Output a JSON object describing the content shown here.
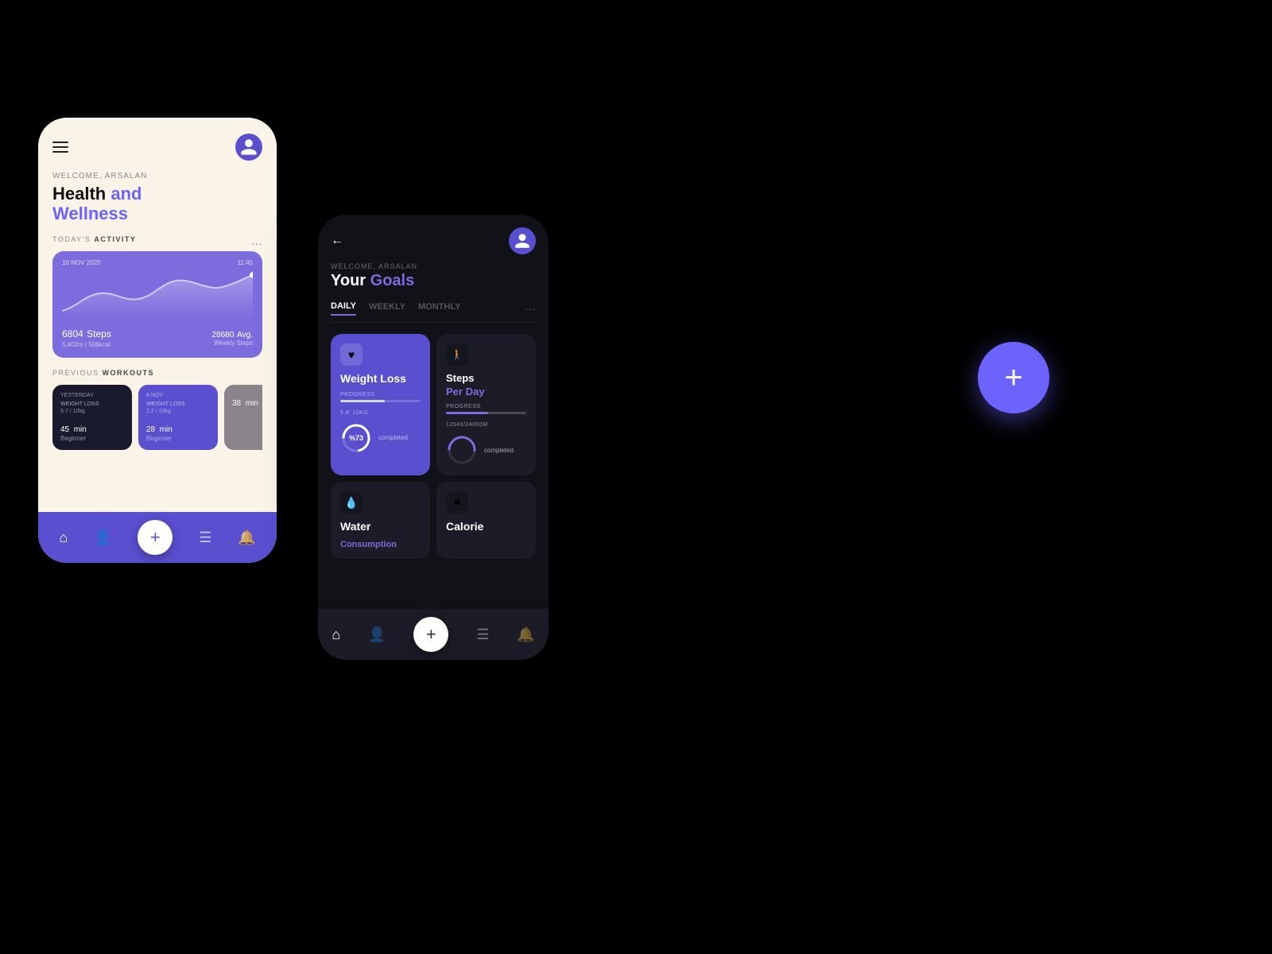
{
  "page": {
    "background": "#000000"
  },
  "phone_light": {
    "welcome_label": "WELCOME, ARSALAN",
    "headline_normal": "Health ",
    "headline_accent": "and",
    "headline_line2": "Wellness",
    "todays_activity": "TODAY'S",
    "activity_bold": "ACTIVITY",
    "chart_date": "10 NOV 2020",
    "chart_time": "11:45",
    "steps_count": "6804",
    "steps_label": "Steps",
    "steps_sub": "5,402m | 508kcal",
    "avg_count": "28680",
    "avg_label": "Avg.",
    "avg_sub": "Weekly Steps",
    "prev_workouts": "PREVIOUS",
    "workouts_bold": "WORKOUTS",
    "workout1_date": "YESTERDAY",
    "workout1_type": "WEIGHT LOSS",
    "workout1_progress": "5.7 / 10kg",
    "workout1_time": "45",
    "workout1_unit": "min",
    "workout1_level": "Beginner",
    "workout2_date": "8 NOV",
    "workout2_type": "WEIGHT LOSS",
    "workout2_progress": "2.2 / 10kg",
    "workout2_time": "28",
    "workout2_unit": "min",
    "workout2_level": "Beginner",
    "workout3_time": "38",
    "workout3_unit": "min"
  },
  "phone_dark": {
    "back": "←",
    "welcome_label": "WELCOME, ARSALAN",
    "headline_normal": "Your ",
    "headline_accent": "Goals",
    "tab_daily": "DAILY",
    "tab_weekly": "WEEKLY",
    "tab_monthly": "MONTHLY",
    "goal1_title": "Weight Loss",
    "goal1_progress_label": "PROGRESS",
    "goal1_progress_value": "5,9' 10kg",
    "goal1_pct": "%73",
    "goal1_completed": "completed",
    "goal2_title": "Steps",
    "goal2_subtitle": "Per Day",
    "goal2_progress_label": "PROGRESS",
    "goal2_progress_value": "12540/24000m",
    "goal2_completed": "completed",
    "goal3_title": "Water",
    "goal3_subtitle": "Consumption",
    "goal4_title": "Calorie"
  },
  "fab": {
    "label": "+"
  },
  "icons": {
    "hamburger": "≡",
    "home": "⌂",
    "person": "👤",
    "clipboard": "📋",
    "bell": "🔔",
    "heart": "♥",
    "walk": "🚶",
    "water": "💧",
    "calories": "✖",
    "plus": "+",
    "back_arrow": "←"
  }
}
